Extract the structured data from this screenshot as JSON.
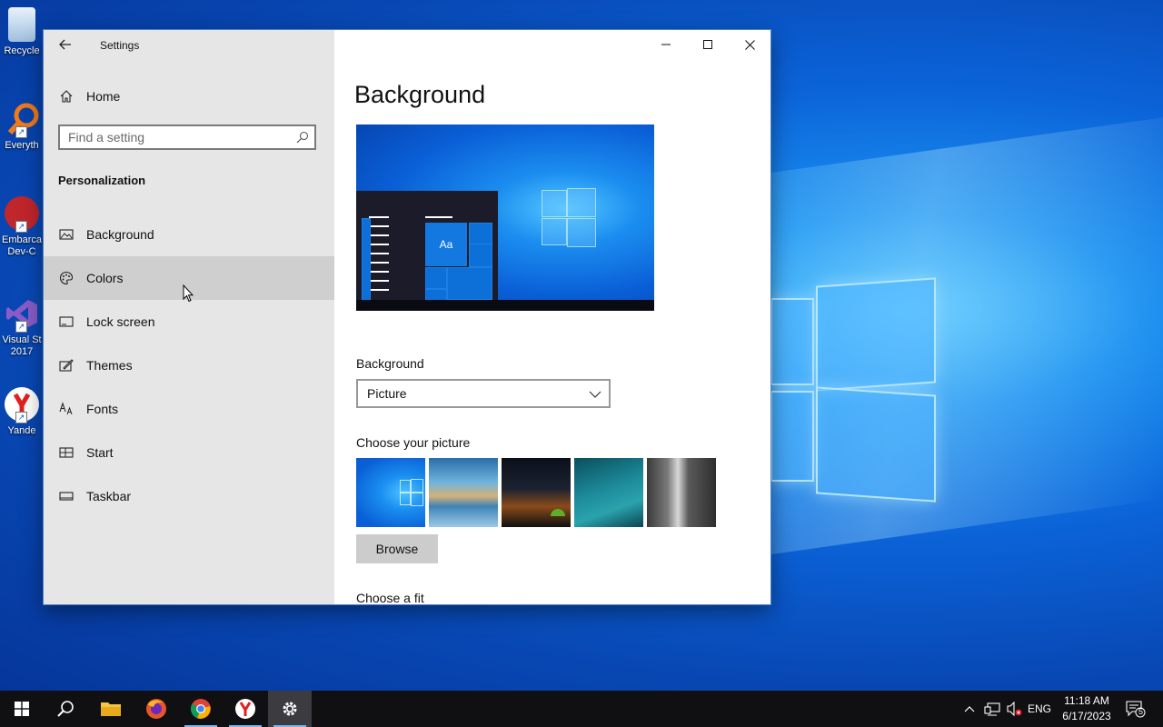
{
  "desktop": {
    "icons": [
      {
        "label": "Recycle"
      },
      {
        "label": "Everyth"
      },
      {
        "label": "Embarca Dev-C"
      },
      {
        "label": "Visual St 2017"
      },
      {
        "label": "Yande"
      }
    ]
  },
  "window": {
    "title": "Settings",
    "sidebar": {
      "home_label": "Home",
      "search_placeholder": "Find a setting",
      "section_title": "Personalization",
      "items": [
        {
          "label": "Background",
          "icon": "picture-icon"
        },
        {
          "label": "Colors",
          "icon": "palette-icon"
        },
        {
          "label": "Lock screen",
          "icon": "lock-screen-icon"
        },
        {
          "label": "Themes",
          "icon": "themes-icon"
        },
        {
          "label": "Fonts",
          "icon": "fonts-icon"
        },
        {
          "label": "Start",
          "icon": "start-icon"
        },
        {
          "label": "Taskbar",
          "icon": "taskbar-icon"
        }
      ]
    },
    "main": {
      "page_title": "Background",
      "preview_tile_text": "Aa",
      "background_label": "Background",
      "background_value": "Picture",
      "choose_picture_label": "Choose your picture",
      "browse_label": "Browse",
      "choose_fit_label": "Choose a fit"
    }
  },
  "taskbar": {
    "language": "ENG",
    "time": "11:18 AM",
    "date": "6/17/2023",
    "notification_count": "5"
  },
  "colors": {
    "accent": "#0078d7",
    "sidebar_bg": "#e6e6e6",
    "hover_bg": "#cfcfcf",
    "taskbar_bg": "#101012"
  }
}
